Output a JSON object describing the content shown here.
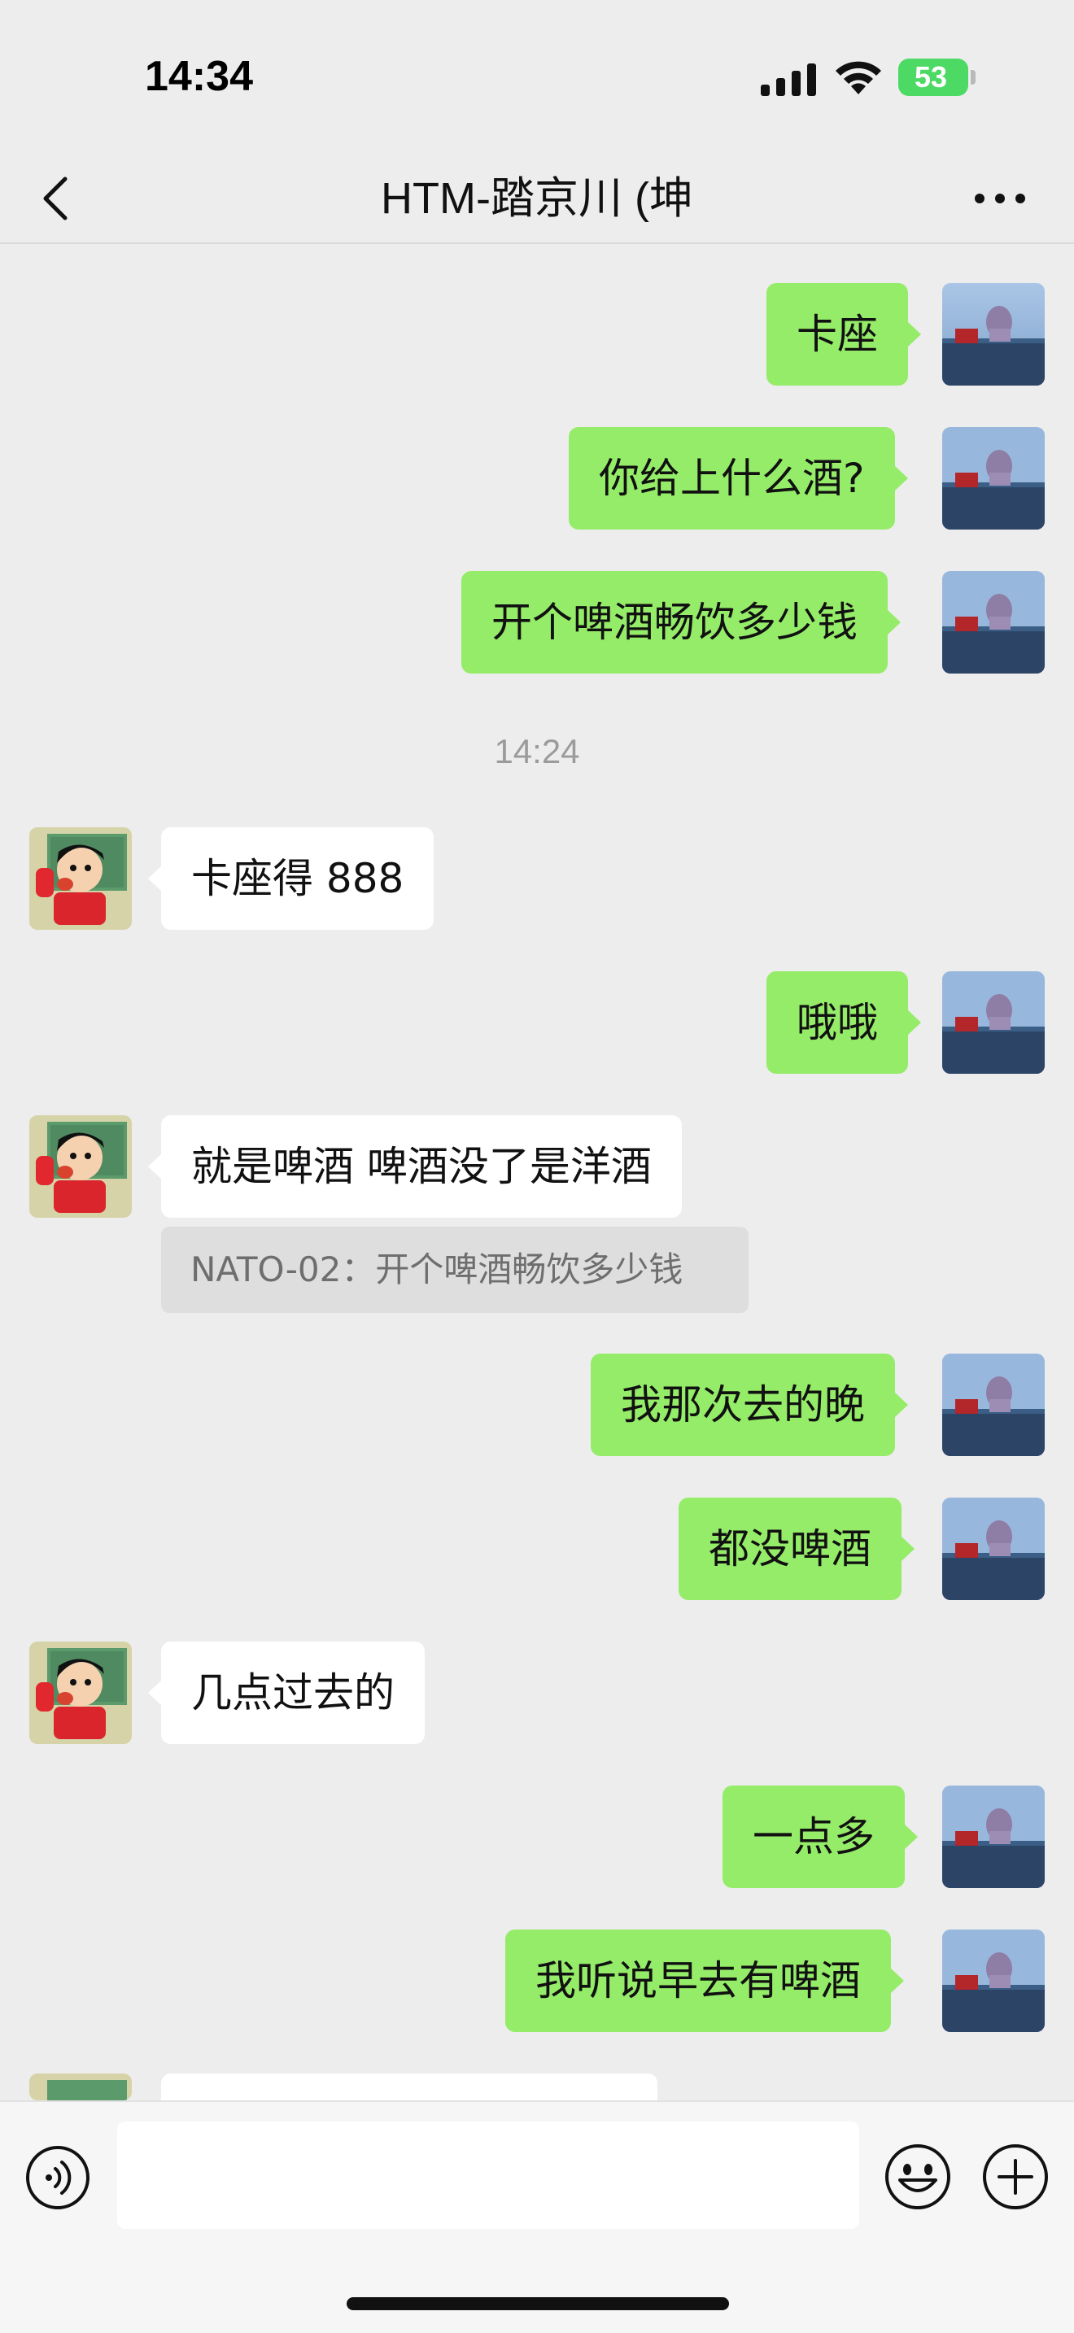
{
  "status_bar": {
    "time": "14:34",
    "battery": "53"
  },
  "header": {
    "title": "HTM-踏京川 (坤"
  },
  "timestamp": "14:24",
  "messages": [
    {
      "sender": "me",
      "text": "卡座"
    },
    {
      "sender": "me",
      "text": "你给上什么酒?"
    },
    {
      "sender": "me",
      "text": "开个啤酒畅饮多少钱"
    },
    {
      "sender": "other",
      "text": "卡座得 888"
    },
    {
      "sender": "me",
      "text": "哦哦"
    },
    {
      "sender": "other",
      "text": "就是啤酒 啤酒没了是洋酒",
      "quote": "NATO-02：开个啤酒畅饮多少钱"
    },
    {
      "sender": "me",
      "text": "我那次去的晚"
    },
    {
      "sender": "me",
      "text": "都没啤酒"
    },
    {
      "sender": "other",
      "text": "几点过去的"
    },
    {
      "sender": "me",
      "text": "一点多"
    },
    {
      "sender": "me",
      "text": "我听说早去有啤酒"
    }
  ],
  "input": {
    "value": "",
    "icons": [
      "voice-icon",
      "emoji-icon",
      "plus-icon"
    ]
  },
  "colors": {
    "my_bubble": "#95ec69",
    "other_bubble": "#ffffff",
    "background": "#ededed"
  }
}
